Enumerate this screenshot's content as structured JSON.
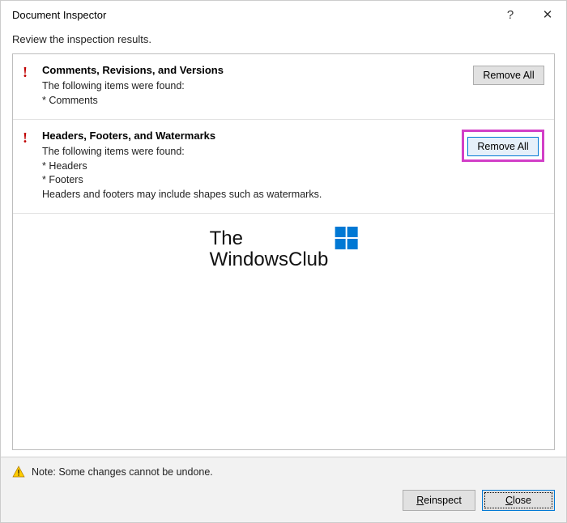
{
  "titlebar": {
    "title": "Document Inspector",
    "help_icon": "?",
    "close_icon": "✕"
  },
  "subheading": "Review the inspection results.",
  "results": [
    {
      "title": "Comments, Revisions, and Versions",
      "lines": [
        "The following items were found:",
        "* Comments"
      ],
      "remove_label": "Remove All",
      "highlighted": false
    },
    {
      "title": "Headers, Footers, and Watermarks",
      "lines": [
        "The following items were found:",
        "* Headers",
        "* Footers",
        "Headers and footers may include shapes such as watermarks."
      ],
      "remove_label": "Remove All",
      "highlighted": true
    }
  ],
  "watermark": {
    "line1": "The",
    "line2": "WindowsClub"
  },
  "footer": {
    "note": "Note: Some changes cannot be undone.",
    "reinspect_label": "Reinspect",
    "reinspect_mnemonic": "R",
    "close_label": "Close",
    "close_mnemonic": "C"
  }
}
